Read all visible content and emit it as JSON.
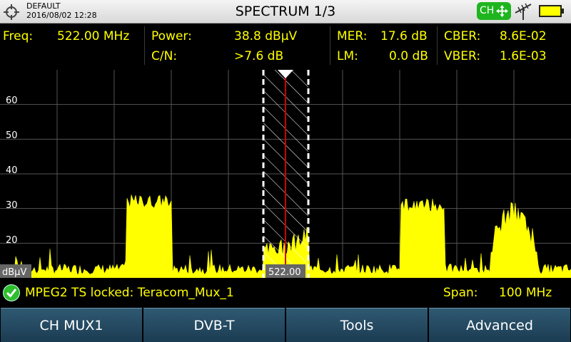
{
  "header": {
    "profile": "DEFAULT",
    "datetime": "2016/08/02 12:28",
    "title": "SPECTRUM 1/3",
    "ch_badge": "CH"
  },
  "measurements": {
    "freq_label": "Freq:",
    "freq_value": "522.00 MHz",
    "power_label": "Power:",
    "power_value": "38.8 dBµV",
    "cn_label": "C/N:",
    "cn_value": ">7.6 dB",
    "mer_label": "MER:",
    "mer_value": "17.6 dB",
    "lm_label": "LM:",
    "lm_value": "0.0 dB",
    "cber_label": "CBER:",
    "cber_value": "8.6E-02",
    "vber_label": "VBER:",
    "vber_value": "1.6E-03"
  },
  "plot": {
    "y_ticks": [
      "60",
      "50",
      "40",
      "30",
      "20"
    ],
    "unit_label": "dBµV",
    "marker_label": "522.00"
  },
  "chart_data": {
    "type": "area",
    "ylim": [
      10,
      70
    ],
    "y_ticks": [
      20,
      30,
      40,
      50,
      60
    ],
    "marker_value": 522.0,
    "span": "100 MHz",
    "unit": "dBµV",
    "channels": [
      {
        "value": 32,
        "noise": 2
      },
      {
        "value": 19,
        "noise": 3
      },
      {
        "value": 31,
        "noise": 2
      },
      {
        "value": 27,
        "noise": 3
      }
    ]
  },
  "status": {
    "lock_text": "MPEG2 TS locked: Teracom_Mux_1",
    "span_label": "Span:",
    "span_value": "100 MHz"
  },
  "softkeys": [
    "CH MUX1",
    "DVB-T",
    "Tools",
    "Advanced"
  ],
  "colors": {
    "trace": "#ffff00",
    "marker": "#cc0000",
    "grid": "#555555",
    "ch_badge": "#1fb51f"
  }
}
